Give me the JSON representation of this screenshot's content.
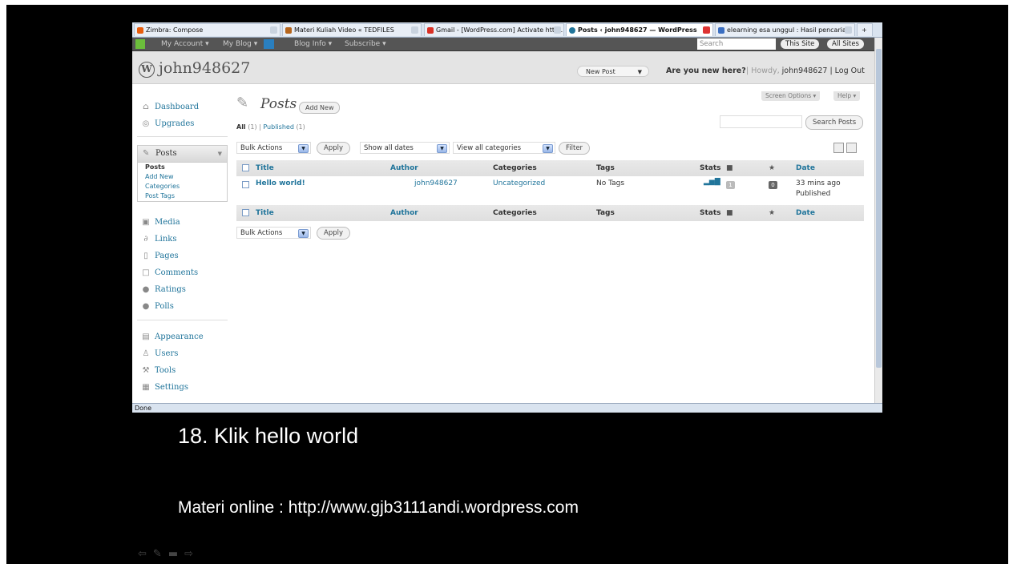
{
  "browser": {
    "tabs": [
      {
        "label": "Zimbra: Compose",
        "active": false
      },
      {
        "label": "Materi Kuliah Video « TEDFILES",
        "active": false
      },
      {
        "label": "Gmail - [WordPress.com] Activate http...",
        "active": false
      },
      {
        "label": "Posts ‹ john948627 — WordPress",
        "active": true
      },
      {
        "label": "elearning esa unggul : Hasil pencarian",
        "active": false
      }
    ],
    "status": "Done"
  },
  "adminbar": {
    "my_account": "My Account ▾",
    "my_blog": "My Blog ▾",
    "blog_info": "Blog Info ▾",
    "subscribe": "Subscribe ▾",
    "search_placeholder": "Search WordPress.com",
    "this_site": "This Site",
    "all_sites": "All Sites"
  },
  "header": {
    "site_name": "john948627",
    "new_post": "New Post",
    "new_here": "Are you new here?",
    "howdy_prefix": "| Howdy,",
    "username": "john948627",
    "logout": "| Log Out"
  },
  "sidebar": {
    "dashboard": "Dashboard",
    "upgrades": "Upgrades",
    "posts": "Posts",
    "submenu": [
      "Posts",
      "Add New",
      "Categories",
      "Post Tags"
    ],
    "items_a": [
      "Media",
      "Links",
      "Pages",
      "Comments",
      "Ratings",
      "Polls"
    ],
    "items_b": [
      "Appearance",
      "Users",
      "Tools",
      "Settings"
    ]
  },
  "main": {
    "title": "Posts",
    "add_new": "Add New",
    "filter_all": "All",
    "filter_all_count": "(1)",
    "filter_sep": "|",
    "filter_published": "Published",
    "filter_published_count": "(1)",
    "screen_options": "Screen Options ▾",
    "help": "Help ▾",
    "search_posts": "Search Posts",
    "bulk_actions": "Bulk Actions",
    "apply": "Apply",
    "show_all_dates": "Show all dates",
    "view_all_categories": "View all categories",
    "filter": "Filter"
  },
  "table": {
    "columns": {
      "title": "Title",
      "author": "Author",
      "categories": "Categories",
      "tags": "Tags",
      "stats": "Stats",
      "date": "Date"
    },
    "rows": [
      {
        "title": "Hello world!",
        "author": "john948627",
        "categories": "Uncategorized",
        "tags": "No Tags",
        "comments": "1",
        "rating": "0",
        "date": "33 mins ago",
        "status": "Published"
      }
    ]
  },
  "captions": {
    "step": "18. Klik hello world",
    "materi": "Materi online : http://www.gjb3111andi.wordpress.com"
  },
  "colors": {
    "link": "#21759b",
    "frame": "#000000",
    "admin_bar": "#555555"
  },
  "icons": [
    "back-arrow-icon",
    "pen-icon",
    "screen-icon",
    "forward-arrow-icon"
  ]
}
